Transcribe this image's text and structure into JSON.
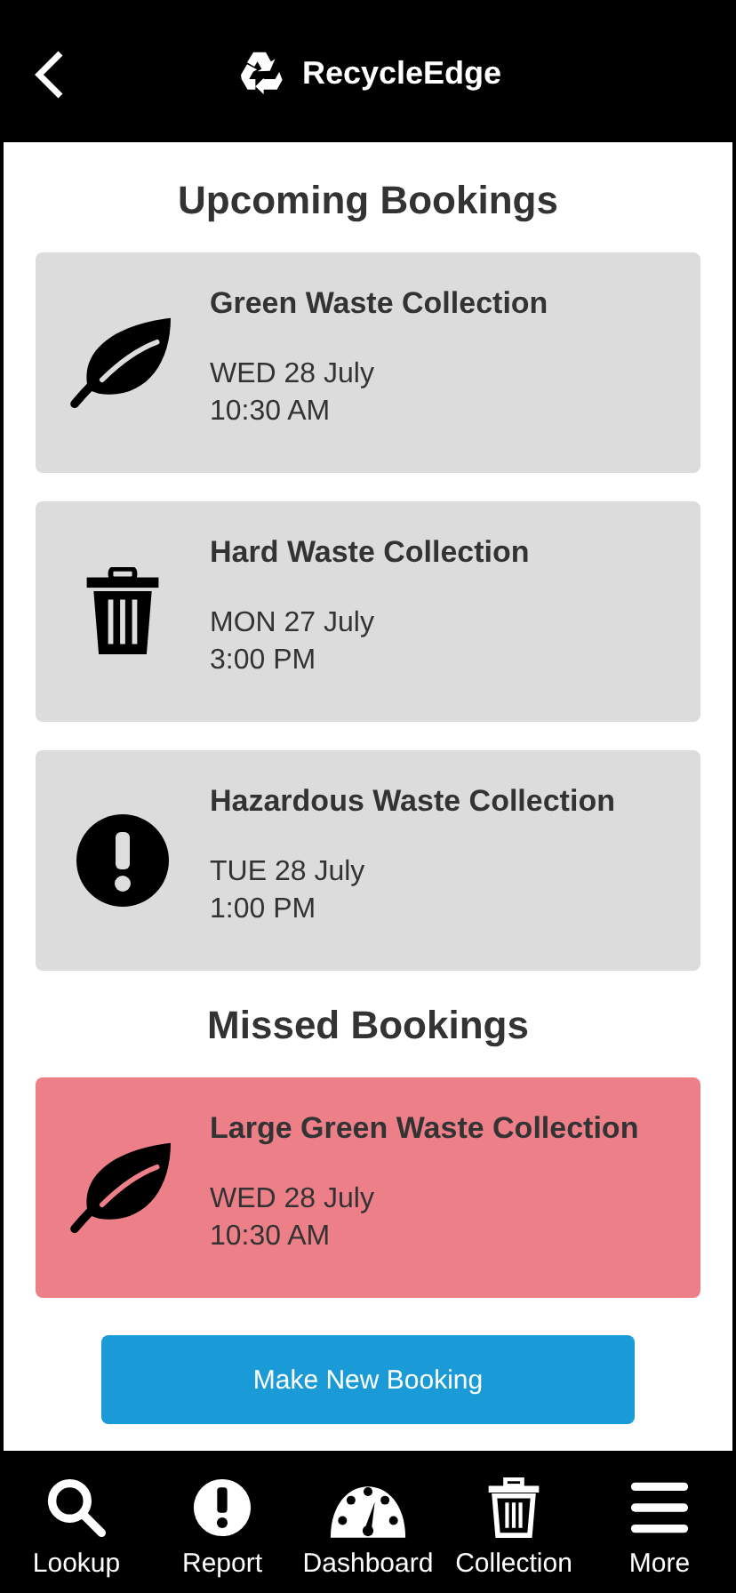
{
  "header": {
    "title": "RecycleEdge"
  },
  "upcoming": {
    "heading": "Upcoming Bookings",
    "bookings": [
      {
        "kind": "green",
        "title": "Green Waste Collection",
        "date": "WED 28 July",
        "time": "10:30 AM"
      },
      {
        "kind": "hard",
        "title": "Hard Waste Collection",
        "date": "MON 27 July",
        "time": "3:00 PM"
      },
      {
        "kind": "hazardous",
        "title": "Hazardous Waste Collection",
        "date": "TUE 28 July",
        "time": "1:00 PM"
      }
    ]
  },
  "missed": {
    "heading": "Missed Bookings",
    "bookings": [
      {
        "kind": "green",
        "title": "Large Green Waste Collection",
        "date": "WED 28 July",
        "time": "10:30 AM"
      }
    ]
  },
  "action_button": "Make New Booking",
  "nav": [
    {
      "kind": "search",
      "label": "Lookup"
    },
    {
      "kind": "alert",
      "label": "Report"
    },
    {
      "kind": "gauge",
      "label": "Dashboard"
    },
    {
      "kind": "trash",
      "label": "Collection"
    },
    {
      "kind": "menu",
      "label": "More"
    }
  ]
}
